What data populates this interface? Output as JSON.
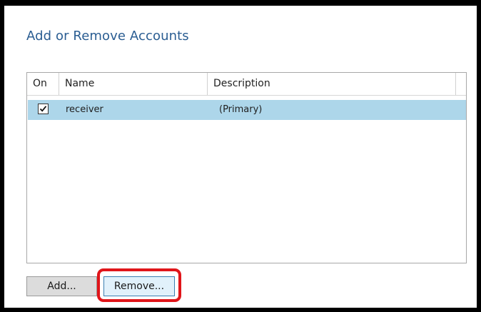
{
  "dialog": {
    "title": "Add or Remove Accounts"
  },
  "accounts_list": {
    "columns": {
      "on": "On",
      "name": "Name",
      "description": "Description"
    },
    "rows": [
      {
        "checked": true,
        "name": "receiver",
        "description": "(Primary)",
        "selected": true
      }
    ]
  },
  "buttons": {
    "add_label": "Add...",
    "remove_label": "Remove..."
  },
  "colors": {
    "title": "#2a5d92",
    "selected_row": "#add6ea",
    "highlight_annotation": "#e0151a"
  }
}
